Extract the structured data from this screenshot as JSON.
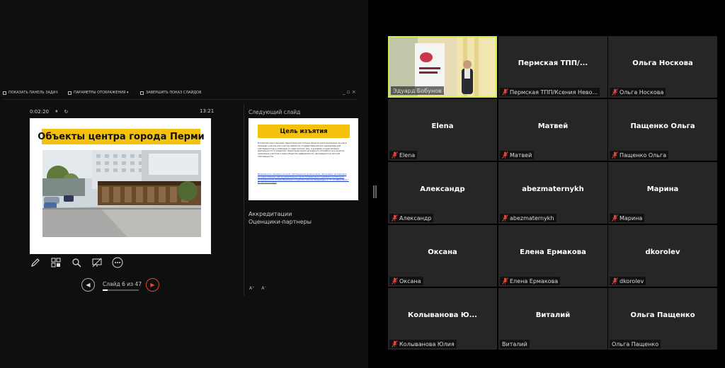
{
  "presenter": {
    "toolbar": {
      "show_taskbar": "ПОКАЗАТЬ ПАНЕЛЬ ЗАДАЧ",
      "display_settings": "ПАРАМЕТРЫ ОТОБРАЖЕНИЯ ▾",
      "end_show": "ЗАВЕРШИТЬ ПОКАЗ СЛАЙДОВ",
      "win_controls": "_ ▫ ×"
    },
    "timer": "0:02:20",
    "clock": "13:21",
    "current_slide": {
      "title": "Объекты центра города Перми"
    },
    "next_slide": {
      "label": "Следующий слайд",
      "title": "Цель изъятия",
      "body": "В комплексном освоении территории рассчитаны объекты расположенные на ней в границах участка или участки являются государственной или муниципальной собственностью и свободны от прав третьих лиц. А в рамках осуществления деятельности по развитию территории может возникнуть потребность в изъятии земельных участков и иных объектов недвижимости, находящихся в частной собственности.",
      "link": "Возможность изъятия частной собственности должна быть обоснована интересами государственных или муниципальных нужд (Определение Судебной коллегии по экономическим спорам Верховного Суда Российской Федерации от 27 октября 2015 г. № 308-ЭС15-5924)"
    },
    "notes": [
      "Аккредитации",
      "Оценщики-партнеры"
    ],
    "nav": {
      "label": "Слайд 6 из 47",
      "current": 6,
      "total": 47
    },
    "font_controls": [
      "A⁺",
      "A⁻"
    ]
  },
  "participants": [
    {
      "name": "",
      "label": "Эдуард Бобунов",
      "video": true,
      "muted": false
    },
    {
      "name": "Пермская ТПП/...",
      "label": "Пермская ТПП/Ксения Нево...",
      "muted": true
    },
    {
      "name": "Ольга Носкова",
      "label": "Ольга Носкова",
      "muted": true
    },
    {
      "name": "Elena",
      "label": "Elena",
      "muted": true
    },
    {
      "name": "Матвей",
      "label": "Матвей",
      "muted": true
    },
    {
      "name": "Пащенко Ольга",
      "label": "Пащенко Ольга",
      "muted": true
    },
    {
      "name": "Александр",
      "label": "Александр",
      "muted": true
    },
    {
      "name": "abezmaternykh",
      "label": "abezmaternykh",
      "muted": true
    },
    {
      "name": "Марина",
      "label": "Марина",
      "muted": true
    },
    {
      "name": "Оксана",
      "label": "Оксана",
      "muted": true
    },
    {
      "name": "Елена Ермакова",
      "label": "Елена Ермакова",
      "muted": true
    },
    {
      "name": "dkorolev",
      "label": "dkorolev",
      "muted": true
    },
    {
      "name": "Колыванова Ю...",
      "label": "Колыванова Юлия",
      "muted": true
    },
    {
      "name": "Виталий",
      "label": "Виталий",
      "muted": false
    },
    {
      "name": "Ольга Пащенко",
      "label": "Ольга Пащенко",
      "muted": false
    }
  ],
  "colors": {
    "slide_title_bg": "#f4c20d",
    "active_speaker_border": "#d7e84a",
    "mic_off": "#e0463a",
    "tile_bg": "#262626"
  }
}
